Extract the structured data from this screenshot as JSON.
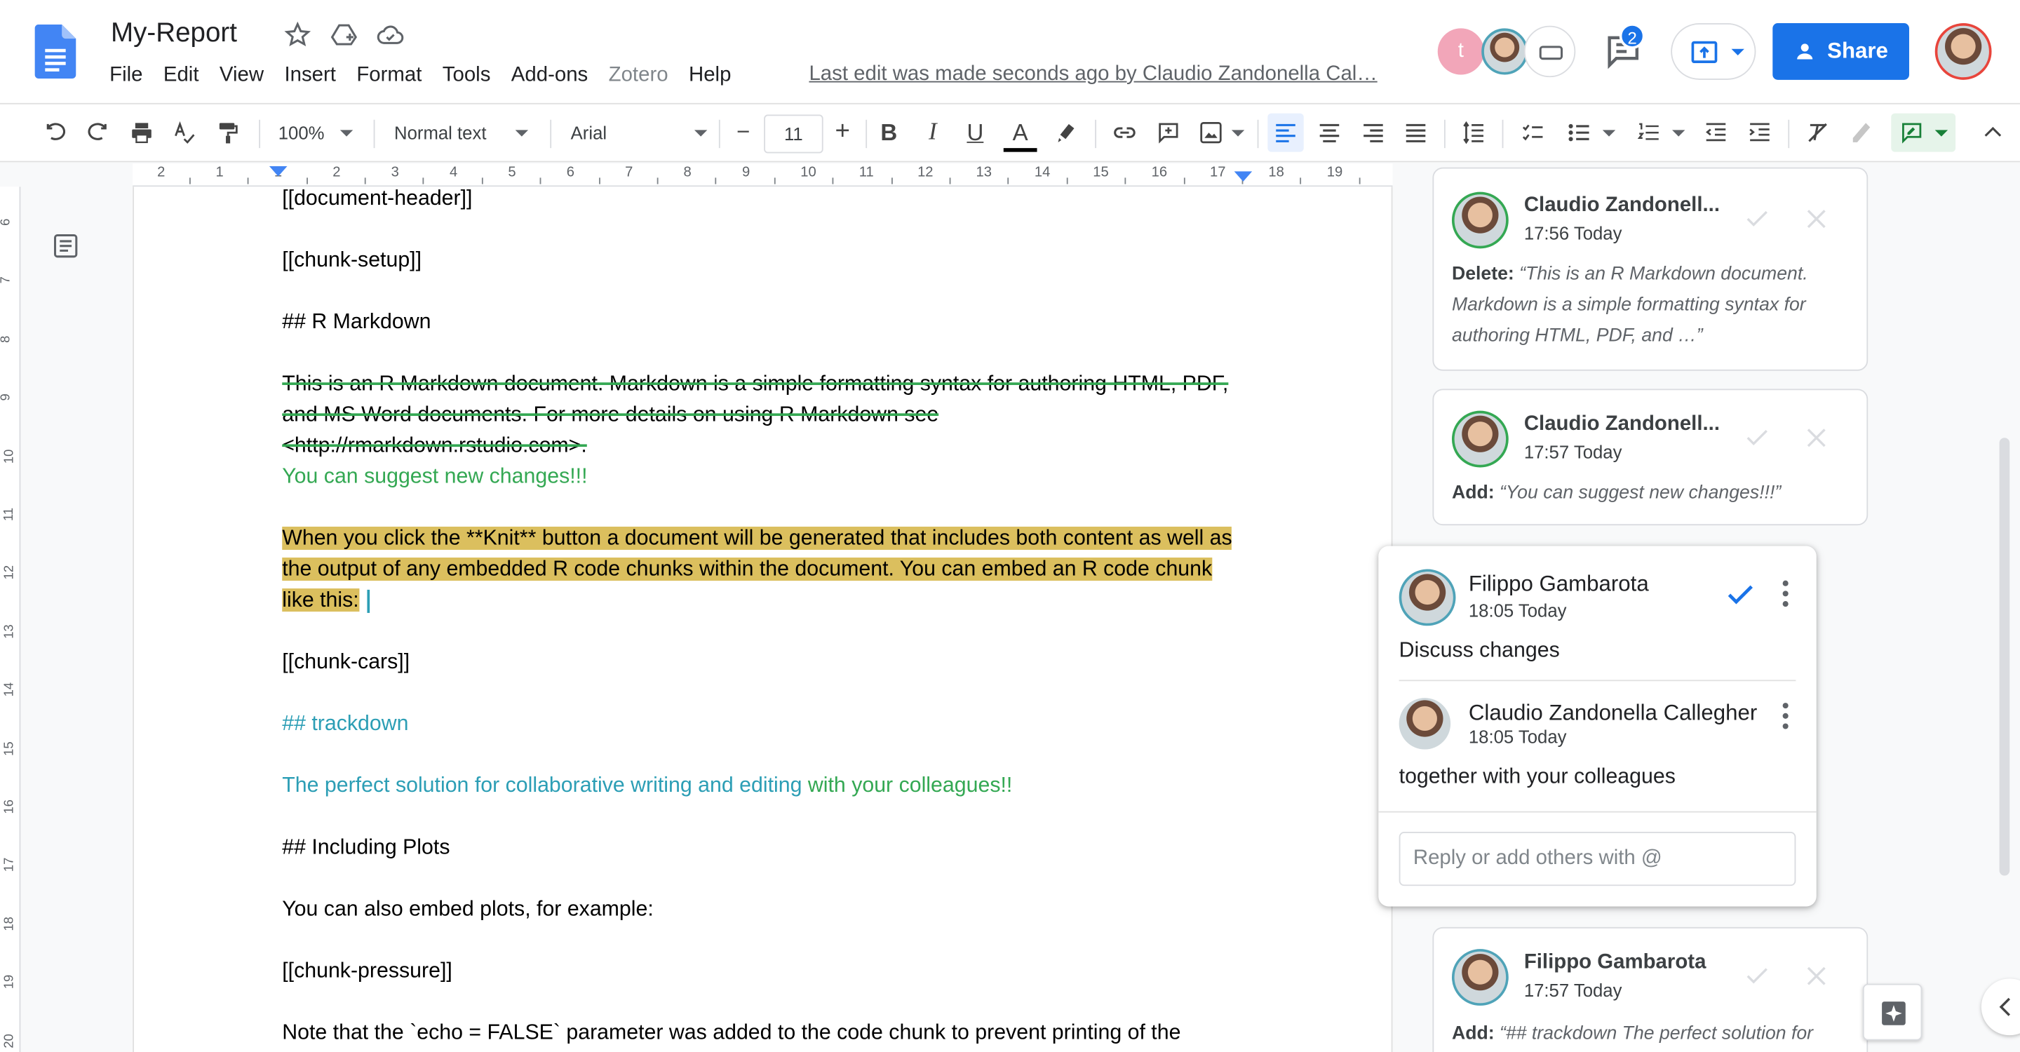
{
  "header": {
    "title": "My-Report",
    "last_edit": "Last edit was made seconds ago by Claudio Zandonella Cal…",
    "share_label": "Share",
    "comments_badge": "2",
    "viewer_initial": "t"
  },
  "menu": [
    "File",
    "Edit",
    "View",
    "Insert",
    "Format",
    "Tools",
    "Add-ons",
    "Zotero",
    "Help"
  ],
  "toolbar": {
    "zoom": "100%",
    "style": "Normal text",
    "font": "Arial",
    "font_size": "11",
    "minus": "−",
    "plus": "+",
    "bold": "B",
    "italic": "I",
    "underline": "U",
    "text_color": "A"
  },
  "ruler": {
    "labels": [
      "2",
      "1",
      "1",
      "2",
      "3",
      "4",
      "5",
      "6",
      "7",
      "8",
      "9",
      "10",
      "11",
      "12",
      "13",
      "14",
      "15",
      "16",
      "17",
      "18",
      "19"
    ],
    "vlabels": [
      "6",
      "7",
      "8",
      "9",
      "10",
      "11",
      "12",
      "13",
      "14",
      "15",
      "16",
      "17",
      "18",
      "19",
      "20"
    ]
  },
  "document": {
    "p1": "[[document-header]]",
    "p2": "[[chunk-setup]]",
    "p3": "## R Markdown",
    "p4_deleted": "This is an R Markdown document. Markdown is a simple formatting syntax for authoring HTML, PDF, and MS Word documents. For more details on using R Markdown see <http://rmarkdown.rstudio.com>.",
    "p4_added": "You can suggest new changes!!!",
    "p5": "When you click the **Knit** button a document will be generated that includes both content as well as the output of any embedded R code chunks within the document. You can embed an R code chunk like this:",
    "p6": "[[chunk-cars]]",
    "p7": "## trackdown",
    "p8_a": "The perfect solution for collaborative writing and editing",
    "p8_b": " with your colleagues!!",
    "p9": "## Including Plots",
    "p10": "You can also embed plots, for example:",
    "p11": "[[chunk-pressure]]",
    "p12": "Note that the `echo = FALSE` parameter was added to the code chunk to prevent printing of the"
  },
  "comments": [
    {
      "name": "Claudio Zandonell...",
      "time": "17:56 Today",
      "kind": "Delete:",
      "text": "“This is an R Markdown document. Markdown is a simple formatting syntax for authoring HTML, PDF, and …”"
    },
    {
      "name": "Claudio Zandonell...",
      "time": "17:57 Today",
      "kind": "Add:",
      "text": "“You can suggest new changes!!!”"
    },
    {
      "name": "Filippo Gambarota",
      "time": "17:57 Today",
      "kind": "Add:",
      "text": "“## trackdown The perfect solution for"
    }
  ],
  "thread": {
    "author": "Filippo Gambarota",
    "time": "18:05 Today",
    "text": "Discuss changes",
    "reply_author": "Claudio Zandonella Callegher",
    "reply_time": "18:05 Today",
    "reply_text": "together with your colleagues",
    "reply_placeholder": "Reply or add others with @"
  },
  "colors": {
    "accent": "#1a73e8",
    "suggest_green": "#34a853",
    "suggest_teal": "#2c9eb5",
    "highlight": "#dbbf5e"
  }
}
